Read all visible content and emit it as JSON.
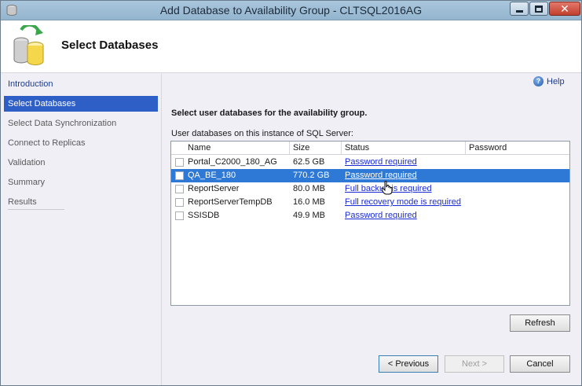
{
  "window": {
    "title": "Add Database to Availability Group - CLTSQL2016AG"
  },
  "header": {
    "title": "Select Databases"
  },
  "nav": {
    "items": [
      {
        "label": "Introduction"
      },
      {
        "label": "Select Databases"
      },
      {
        "label": "Select Data Synchronization"
      },
      {
        "label": "Connect to Replicas"
      },
      {
        "label": "Validation"
      },
      {
        "label": "Summary"
      },
      {
        "label": "Results"
      }
    ]
  },
  "help": {
    "label": "Help"
  },
  "main": {
    "instruction": "Select user databases for the availability group.",
    "grid_label": "User databases on this instance of SQL Server:",
    "columns": [
      "Name",
      "Size",
      "Status",
      "Password"
    ],
    "rows": [
      {
        "name": "Portal_C2000_180_AG",
        "size": "62.5 GB",
        "status": "Password required",
        "password": "",
        "checked": false,
        "selected": false
      },
      {
        "name": "QA_BE_180",
        "size": "770.2 GB",
        "status": "Password required",
        "password": "",
        "checked": false,
        "selected": true
      },
      {
        "name": "ReportServer",
        "size": "80.0 MB",
        "status": "Full backup is required",
        "password": "",
        "checked": false,
        "selected": false
      },
      {
        "name": "ReportServerTempDB",
        "size": "16.0 MB",
        "status": "Full recovery mode is required",
        "password": "",
        "checked": false,
        "selected": false
      },
      {
        "name": "SSISDB",
        "size": "49.9 MB",
        "status": "Password required",
        "password": "",
        "checked": false,
        "selected": false
      }
    ]
  },
  "buttons": {
    "refresh": "Refresh",
    "previous": "< Previous",
    "next": "Next >",
    "cancel": "Cancel"
  },
  "colors": {
    "selection": "#2e5fc7",
    "row_selection": "#2e78d6",
    "link": "#1a2bd6"
  }
}
